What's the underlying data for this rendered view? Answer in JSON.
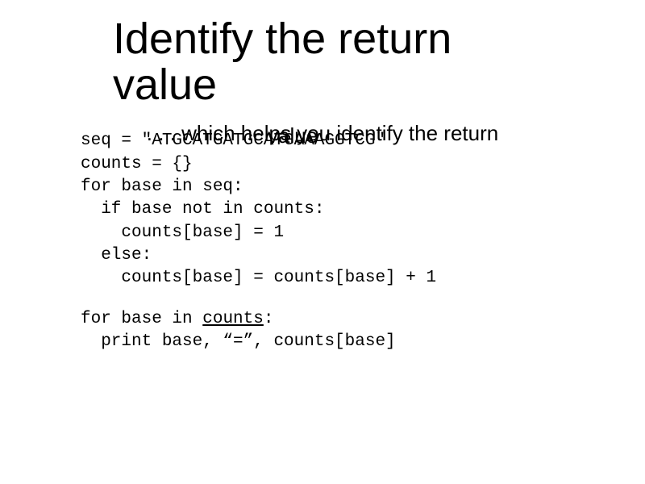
{
  "title_line1": "Identify the return",
  "title_line2": "value",
  "subtitle_line1": ". . . which helps you identify the return",
  "subtitle_line2_word": "value",
  "code": {
    "l1": "seq = \"ATGCATGATGCATGAAAGGTCG\"",
    "l2": "counts = {}",
    "l3": "for base in seq:",
    "l4": "  if base not in counts:",
    "l5": "    counts[base] = 1",
    "l6": "  else:",
    "l7": "    counts[base] = counts[base] + 1",
    "l8a": "for base in ",
    "l8b": "counts",
    "l8c": ":",
    "l9": "  print base, “=”, counts[base]"
  }
}
